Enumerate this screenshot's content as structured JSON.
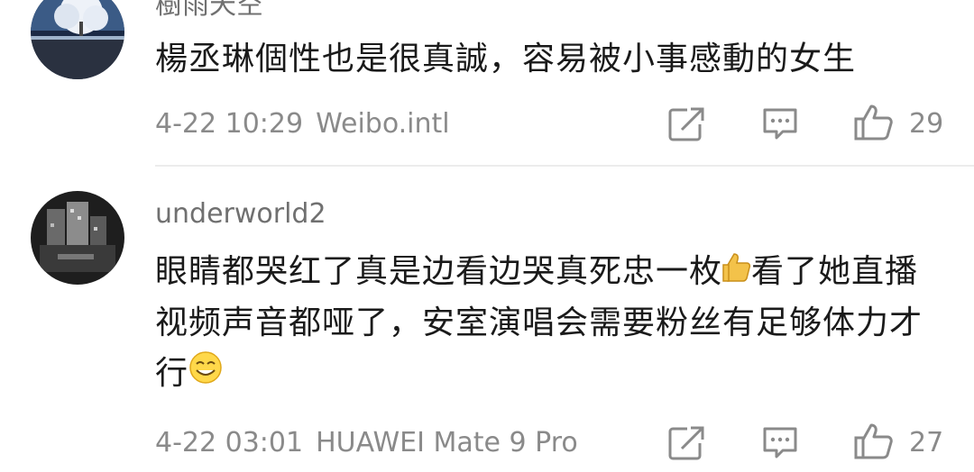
{
  "comments": [
    {
      "username": "樹雨天空",
      "text": "楊丞琳個性也是很真誠，容易被小事感動的女生",
      "time": "4-22 10:29",
      "source": "Weibo.intl",
      "likes": "29",
      "avatar_icon": "tree-snow-avatar"
    },
    {
      "username": "underworld2",
      "text_part1": "眼睛都哭红了真是边看边哭真死忠一枚",
      "text_part2": "看了她直播视频声音都哑了，安室演唱会需要粉丝有足够体力才行",
      "emoji1": "thumbs-up-emoji",
      "emoji2": "smiling-face-emoji",
      "time": "4-22 03:01",
      "source": "HUAWEI Mate 9 Pro",
      "likes": "27",
      "avatar_icon": "city-night-avatar"
    }
  ],
  "icons": {
    "repost": "repost-icon",
    "comment": "comment-icon",
    "like": "thumbs-up-icon"
  },
  "colors": {
    "text": "#1a1a1a",
    "meta": "#8a8a8a",
    "divider": "#ececec"
  }
}
